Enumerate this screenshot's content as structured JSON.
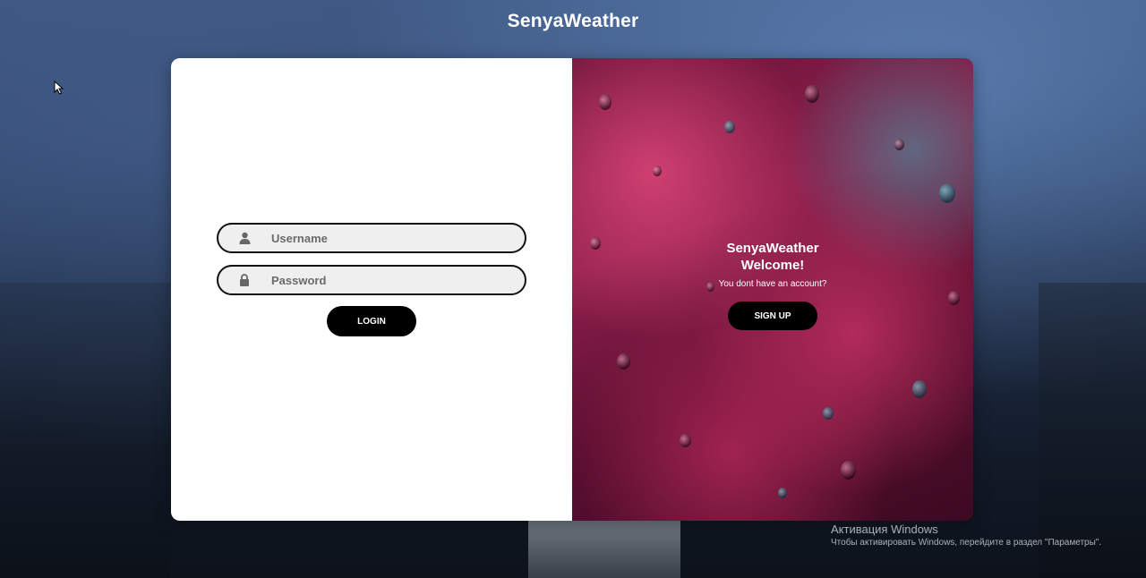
{
  "header": {
    "site_title": "SenyaWeather"
  },
  "login_form": {
    "username_placeholder": "Username",
    "password_placeholder": "Password",
    "login_label": "LOGIN",
    "username_icon": "user-icon",
    "password_icon": "lock-icon"
  },
  "welcome_panel": {
    "brand": "SenyaWeather",
    "greeting": "Welcome!",
    "prompt": "You dont have an account?",
    "signup_label": "SIGN UP"
  },
  "windows_watermark": {
    "title": "Активация Windows",
    "subtitle": "Чтобы активировать Windows, перейдите в раздел \"Параметры\"."
  },
  "colors": {
    "button_bg": "#000000",
    "input_bg": "#efefef",
    "panel_accent": "#8e1f4c"
  }
}
